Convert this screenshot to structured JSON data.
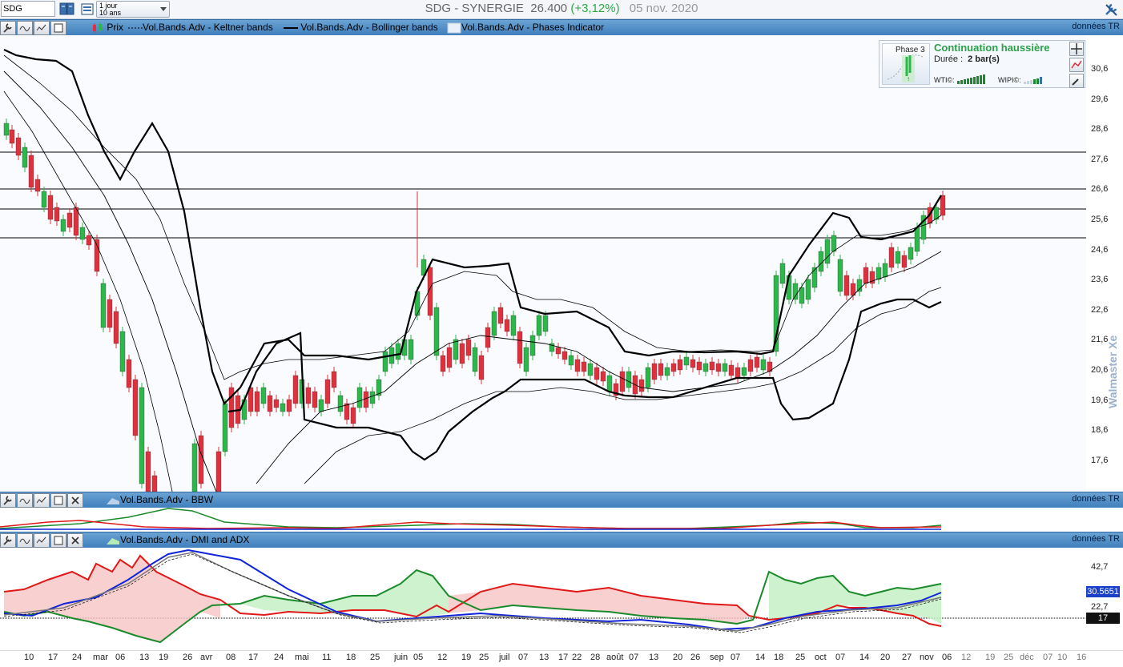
{
  "toolbar": {
    "symbol_value": "SDG",
    "period_line1": "1 jour",
    "period_line2": "10 ans",
    "title_name": "SDG - SYNERGIE",
    "title_price": "26.400",
    "title_change": "(+3,12%)",
    "title_date": "05 nov. 2020"
  },
  "main_panel": {
    "legend_price": "Prix",
    "legend_keltner": "Vol.Bands.Adv - Keltner bands",
    "legend_bollinger": "Vol.Bands.Adv - Bollinger bands",
    "legend_phases": "Vol.Bands.Adv - Phases Indicator",
    "data_source": "données TR",
    "price_axis": [
      "30,6",
      "29,6",
      "28,6",
      "27,6",
      "26,6",
      "25,6",
      "24,6",
      "23,6",
      "22,6",
      "21,6",
      "20,6",
      "19,6",
      "18,6",
      "17,6"
    ],
    "watermark": "Walmaster Xe"
  },
  "phase_box": {
    "phase": "Phase 3",
    "title": "Continuation haussière",
    "duration_label": "Durée :",
    "duration_value": "2 bar(s)",
    "wti_label": "WTI©:",
    "wipi_label": "WIPI©:"
  },
  "bbw_panel": {
    "label": "Vol.Bands.Adv - BBW",
    "data_source": "données TR"
  },
  "dmi_panel": {
    "label": "Vol.Bands.Adv - DMI and ADX",
    "data_source": "données TR",
    "axis": [
      "42,7",
      "22,7"
    ],
    "badge_adx": "30.5651",
    "badge_ref": "17"
  },
  "date_axis": {
    "labels": [
      "10",
      "17",
      "24",
      "mar",
      "06",
      "13",
      "19",
      "26",
      "avr",
      "08",
      "17",
      "24",
      "mai",
      "11",
      "18",
      "25",
      "juin",
      "05",
      "12",
      "19",
      "25",
      "juil",
      "07",
      "13",
      "17",
      "22",
      "28",
      "août",
      "07",
      "13",
      "20",
      "26",
      "sep",
      "07",
      "14",
      "18",
      "25",
      "oct",
      "07",
      "14",
      "20",
      "27",
      "nov",
      "06",
      "12",
      "19",
      "25",
      "déc",
      "07",
      "10",
      "16"
    ]
  },
  "colors": {
    "up_candle": "#2bb84a",
    "down_candle": "#e0303e",
    "dmi_plus": "#1a8a2a",
    "dmi_minus": "#e01818",
    "adx": "#1024d8",
    "accent_bar": "#3f7fbd"
  },
  "icons": [
    "book-icon",
    "list-icon",
    "settings-icon",
    "wrench-icon",
    "wave-icon",
    "info-icon",
    "window-icon",
    "close-icon",
    "candle-icon",
    "move-icon",
    "chart-icon"
  ]
}
